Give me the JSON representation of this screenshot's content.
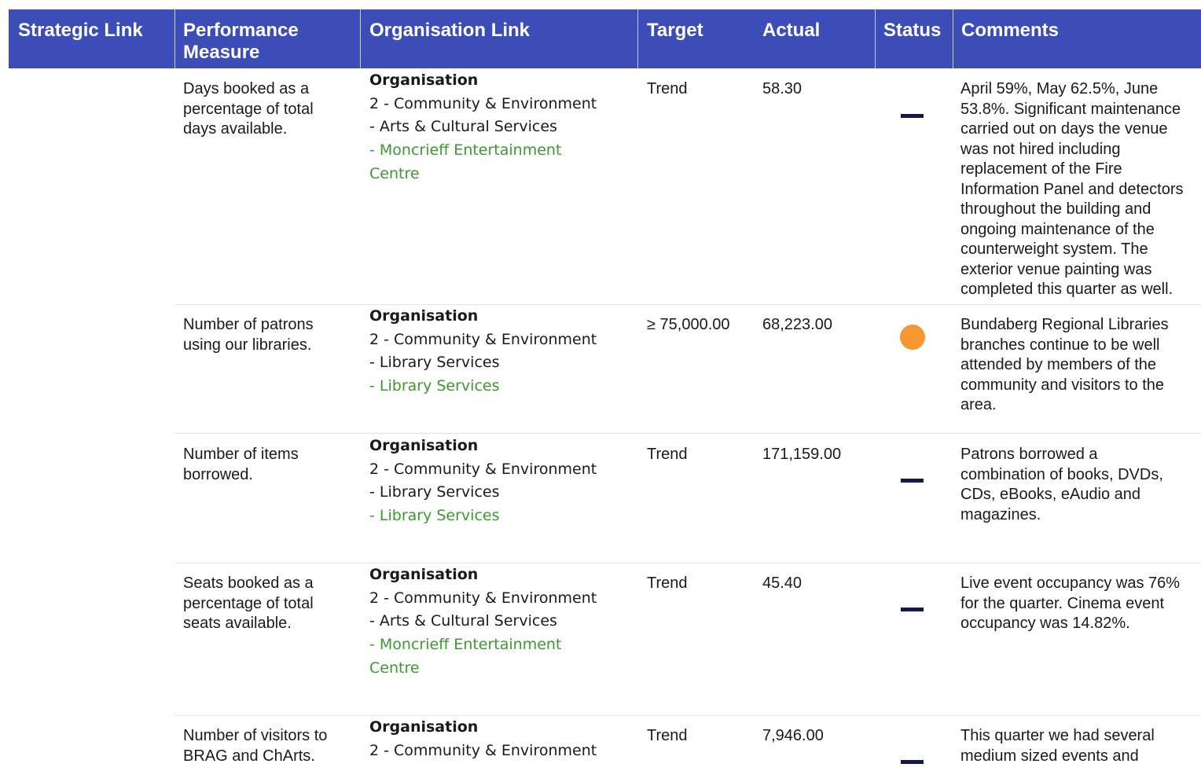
{
  "headers": {
    "strategic_link": "Strategic Link",
    "performance_measure": "Performance\nMeasure",
    "organisation_link": "Organisation Link",
    "target": "Target",
    "actual": "Actual",
    "status": "Status",
    "comments": "Comments"
  },
  "rows": [
    {
      "measure": "Days booked as a\npercentage of total\ndays available.",
      "org_title": "Organisation",
      "org_lines": "2 - Community & Environment\n- Arts & Cultural Services",
      "org_unit": "- Moncrieff Entertainment\nCentre",
      "target": "Trend",
      "actual": "58.30",
      "status_icon": "dash-trend-icon",
      "comments": "April 59%, May 62.5%, June\n53.8%. Significant maintenance\ncarried out on days the venue\nwas not hired including\nreplacement of the Fire\nInformation Panel and detectors\nthroughout the building and\nongoing maintenance of the\ncounterweight system. The\nexterior venue painting was\ncompleted this quarter as well."
    },
    {
      "measure": "Number of patrons\nusing our libraries.",
      "org_title": "Organisation",
      "org_lines": "2 - Community & Environment\n- Library Services",
      "org_unit": "- Library Services",
      "target": "≥ 75,000.00",
      "actual": "68,223.00",
      "status_icon": "orange-circle-status-icon",
      "comments": "Bundaberg Regional Libraries\nbranches continue to be well\nattended by members of the\ncommunity and visitors to the\narea."
    },
    {
      "measure": "Number of items\nborrowed.",
      "org_title": "Organisation",
      "org_lines": "2 - Community & Environment\n- Library Services",
      "org_unit": "- Library Services",
      "target": "Trend",
      "actual": "171,159.00",
      "status_icon": "dash-trend-icon",
      "comments": "Patrons borrowed a\ncombination of books, DVDs,\nCDs, eBooks, eAudio and\nmagazines."
    },
    {
      "measure": "Seats booked as a\npercentage of total\nseats available.",
      "org_title": "Organisation",
      "org_lines": "2 - Community & Environment\n- Arts & Cultural Services",
      "org_unit": "- Moncrieff Entertainment\nCentre",
      "target": "Trend",
      "actual": "45.40",
      "status_icon": "dash-trend-icon",
      "comments": "Live event occupancy was 76%\nfor the quarter. Cinema event\noccupancy was 14.82%."
    },
    {
      "measure": "Number of visitors to\nBRAG and ChArts.",
      "org_title": "Organisation",
      "org_lines": "2 - Community & Environment",
      "org_unit": "",
      "target": "Trend",
      "actual": "7,946.00",
      "status_icon": "dash-trend-icon",
      "comments": "This quarter we had several\nmedium sized events and"
    }
  ],
  "colors": {
    "header_bg": "#3d4db7",
    "green_text": "#3b9a2e",
    "status_orange": "#f6972f",
    "trend_dash": "#111a4a"
  }
}
